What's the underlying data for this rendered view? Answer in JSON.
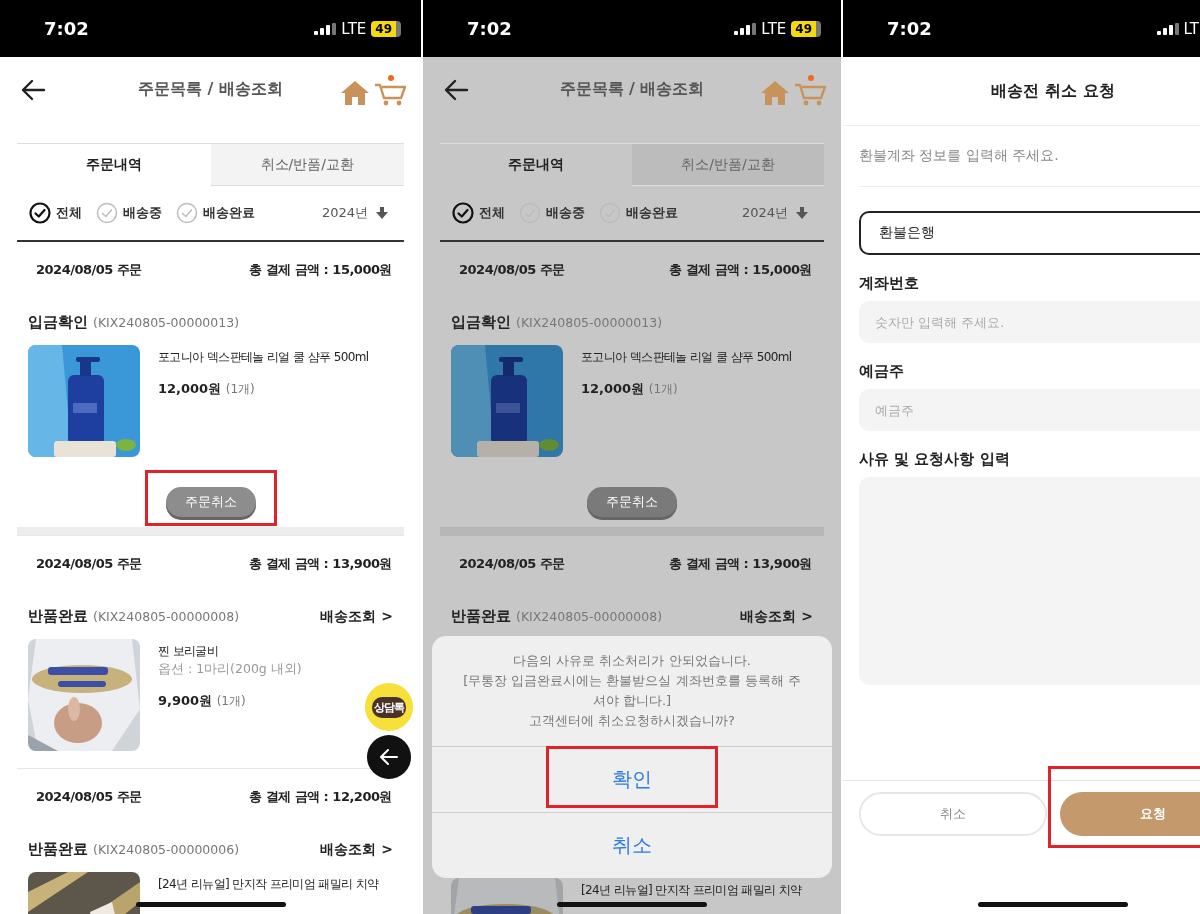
{
  "screens": [
    {
      "kind": "order_list",
      "dimmed": false,
      "status_bar": {
        "time": "7:02",
        "network": "LTE",
        "battery": "49"
      },
      "header": {
        "title": "주문목록 / 배송조회"
      },
      "tabs": [
        {
          "label": "주문내역",
          "selected": true
        },
        {
          "label": "취소/반품/교환",
          "selected": false
        }
      ],
      "filters": [
        {
          "label": "전체",
          "checked": true
        },
        {
          "label": "배송중",
          "checked": false
        },
        {
          "label": "배송완료",
          "checked": false
        }
      ],
      "year": "2024년",
      "rows": [
        {
          "kind": "date",
          "date": "2024/08/05 주문",
          "total": "총 결제 금액 : 15,000원"
        },
        {
          "kind": "status",
          "status": "입금확인",
          "order_no": "(KIX240805-00000013)"
        },
        {
          "kind": "product",
          "name": "포고니아 덱스판테놀 리얼 쿨 샴푸 500ml",
          "price": "12,000원",
          "qty": "(1개)"
        },
        {
          "kind": "action",
          "label": "주문취소",
          "highlighted": true
        },
        {
          "kind": "date",
          "date": "2024/08/05 주문",
          "total": "총 결제 금액 : 13,900원"
        },
        {
          "kind": "status",
          "status": "반품완료",
          "order_no": "(KIX240805-00000008)",
          "link": "배송조회 >"
        },
        {
          "kind": "product",
          "name": "찐 보리굴비",
          "option": "옵션 : 1마리(200g 내외)",
          "price": "9,900원",
          "qty": "(1개)"
        },
        {
          "kind": "date",
          "date": "2024/08/05 주문",
          "total": "총 결제 금액 : 12,200원"
        },
        {
          "kind": "status",
          "status": "반품완료",
          "order_no": "(KIX240805-00000006)",
          "link": "배송조회 >"
        },
        {
          "kind": "product",
          "name": "[24년 리뉴얼] 만지작 프리미엄 패밀리 치약"
        }
      ],
      "floating": {
        "chat": "상담톡"
      }
    },
    {
      "kind": "order_list",
      "dimmed": true,
      "status_bar": {
        "time": "7:02",
        "network": "LTE",
        "battery": "49"
      },
      "header": {
        "title": "주문목록 / 배송조회"
      },
      "tabs": [
        {
          "label": "주문내역",
          "selected": true
        },
        {
          "label": "취소/반품/교환",
          "selected": false
        }
      ],
      "filters": [
        {
          "label": "전체",
          "checked": true
        },
        {
          "label": "배송중",
          "checked": false
        },
        {
          "label": "배송완료",
          "checked": false
        }
      ],
      "year": "2024년",
      "rows": [
        {
          "kind": "date",
          "date": "2024/08/05 주문",
          "total": "총 결제 금액 : 15,000원"
        },
        {
          "kind": "status",
          "status": "입금확인",
          "order_no": "(KIX240805-00000013)"
        },
        {
          "kind": "product",
          "name": "포고니아 덱스판테놀 리얼 쿨 샴푸 500ml",
          "price": "12,000원",
          "qty": "(1개)"
        },
        {
          "kind": "action",
          "label": "주문취소",
          "highlighted": false
        },
        {
          "kind": "date",
          "date": "2024/08/05 주문",
          "total": "총 결제 금액 : 13,900원"
        },
        {
          "kind": "status",
          "status": "반품완료",
          "order_no": "(KIX240805-00000008)",
          "link": "배송조회 >"
        },
        {
          "kind": "dialog",
          "message": "다음의 사유로 취소처리가 안되었습니다.\n[무통장 입금완료시에는 환불받으실 계좌번호를 등록해 주셔야 합니다.]\n고객센터에 취소요청하시겠습니까?",
          "buttons": [
            {
              "label": "확인",
              "highlighted": true
            },
            {
              "label": "취소",
              "highlighted": false
            }
          ]
        },
        {
          "kind": "product",
          "name": "[24년 리뉴얼] 만지작 프리미엄 패밀리 치약"
        }
      ]
    },
    {
      "kind": "cancel_form",
      "status_bar": {
        "time": "7:02",
        "network": "LT"
      },
      "title": "배송전 취소 요청",
      "notice": "환불계좌 정보를 입력해 주세요.",
      "fields": [
        {
          "kind": "select",
          "value": "환불은행"
        },
        {
          "kind": "input",
          "label": "계좌번호",
          "placeholder": "숫자만 입력해 주세요."
        },
        {
          "kind": "input",
          "label": "예금주",
          "placeholder": "예금주"
        },
        {
          "kind": "textarea",
          "label": "사유 및 요청사항 입력"
        }
      ],
      "buttons": [
        {
          "kind": "secondary",
          "label": "취소",
          "highlighted": false
        },
        {
          "kind": "primary",
          "label": "요청",
          "highlighted": true
        }
      ]
    }
  ]
}
